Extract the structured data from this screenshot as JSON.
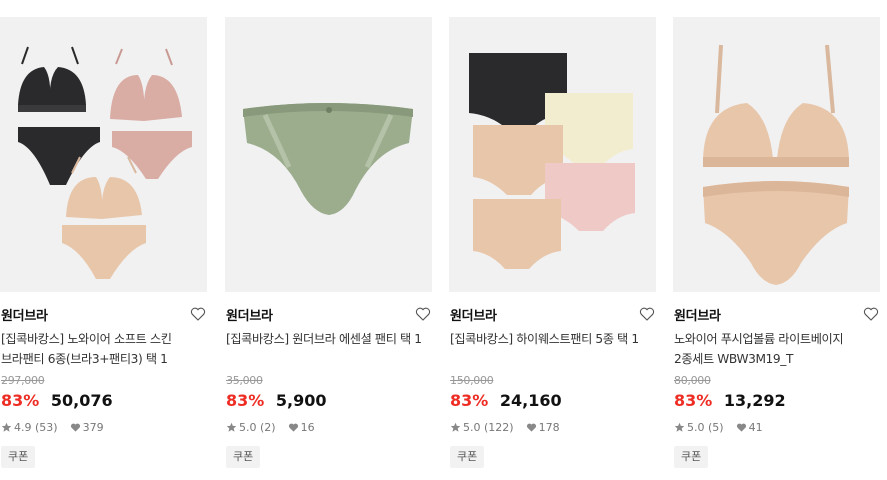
{
  "products": [
    {
      "brand": "원더브라",
      "title": "[집콕바캉스] 노와이어 소프트 스킨 브라팬티 6종(브라3+팬티3) 택 1",
      "original_price": "297,000",
      "discount": "83%",
      "price": "50,076",
      "rating": "4.9 (53)",
      "likes": "379",
      "coupon": "쿠폰",
      "icons": [
        "heart-outline-icon",
        "star-icon",
        "heart-filled-icon"
      ]
    },
    {
      "brand": "원더브라",
      "title": "[집콕바캉스] 원더브라 에센셜 팬티 택 1",
      "original_price": "35,000",
      "discount": "83%",
      "price": "5,900",
      "rating": "5.0 (2)",
      "likes": "16",
      "coupon": "쿠폰"
    },
    {
      "brand": "원더브라",
      "title": "[집콕바캉스] 하이웨스트팬티 5종 택 1",
      "original_price": "150,000",
      "discount": "83%",
      "price": "24,160",
      "rating": "5.0 (122)",
      "likes": "178",
      "coupon": "쿠폰"
    },
    {
      "brand": "원더브라",
      "title": "노와이어 푸시업볼륨 라이트베이지 2종세트 WBW3M19_T",
      "original_price": "80,000",
      "discount": "83%",
      "price": "13,292",
      "rating": "5.0 (5)",
      "likes": "41",
      "coupon": "쿠폰"
    }
  ],
  "colors": {
    "discount": "#ee2e24",
    "thumb_bg": "#f1f1f1",
    "black_set": "#2a2a2c",
    "pink_set": "#d9aca4",
    "nude_set": "#e8c6aa",
    "green_panty": "#9cad8e",
    "ivory_panty": "#f3edcf",
    "light_pink_panty": "#efc9c6"
  }
}
